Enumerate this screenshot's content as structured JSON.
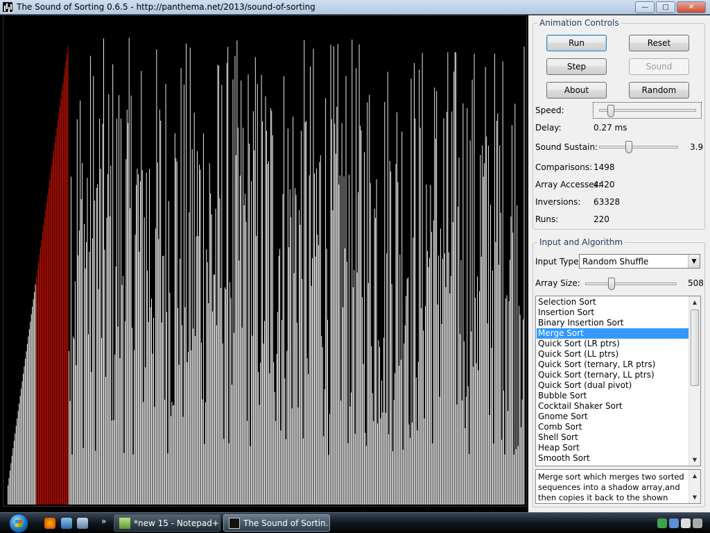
{
  "window": {
    "title": "The Sound of Sorting 0.6.5 - http://panthema.net/2013/sound-of-sorting"
  },
  "visualization": {
    "count": 508,
    "sorted_prefix": 60,
    "highlight_color": "#cc1100",
    "bar_color": "#ffffff",
    "background": "#000000"
  },
  "animation_controls": {
    "title": "Animation Controls",
    "buttons": {
      "run": "Run",
      "reset": "Reset",
      "step": "Step",
      "sound": "Sound",
      "about": "About",
      "random": "Random"
    },
    "speed_label": "Speed:",
    "delay_label": "Delay:",
    "delay_value": "0.27 ms",
    "sustain_label": "Sound Sustain:",
    "sustain_value": "3.9",
    "sustain_fraction": 0.38,
    "speed_fraction": 0.12,
    "stats": {
      "comparisons_label": "Comparisons:",
      "comparisons_value": "1498",
      "accesses_label": "Array Accesses:",
      "accesses_value": "4420",
      "inversions_label": "Inversions:",
      "inversions_value": "63328",
      "runs_label": "Runs:",
      "runs_value": "220"
    }
  },
  "input_algorithm": {
    "title": "Input and Algorithm",
    "input_type_label": "Input Type:",
    "input_type_value": "Random Shuffle",
    "array_size_label": "Array Size:",
    "array_size_value": "508",
    "array_size_fraction": 0.29,
    "algorithms": [
      "Selection Sort",
      "Insertion Sort",
      "Binary Insertion Sort",
      "Merge Sort",
      "Quick Sort (LR ptrs)",
      "Quick Sort (LL ptrs)",
      "Quick Sort (ternary, LR ptrs)",
      "Quick Sort (ternary, LL ptrs)",
      "Quick Sort (dual pivot)",
      "Bubble Sort",
      "Cocktail Shaker Sort",
      "Gnome Sort",
      "Comb Sort",
      "Shell Sort",
      "Heap Sort",
      "Smooth Sort"
    ],
    "selected_index": 3,
    "description": "Merge sort which merges two sorted sequences into a shadow array,and then copies it back to the shown array."
  },
  "taskbar": {
    "more": "»",
    "tasks": [
      {
        "label": "*new 15 - Notepad++"
      },
      {
        "label": "The Sound of Sortin..."
      }
    ]
  }
}
